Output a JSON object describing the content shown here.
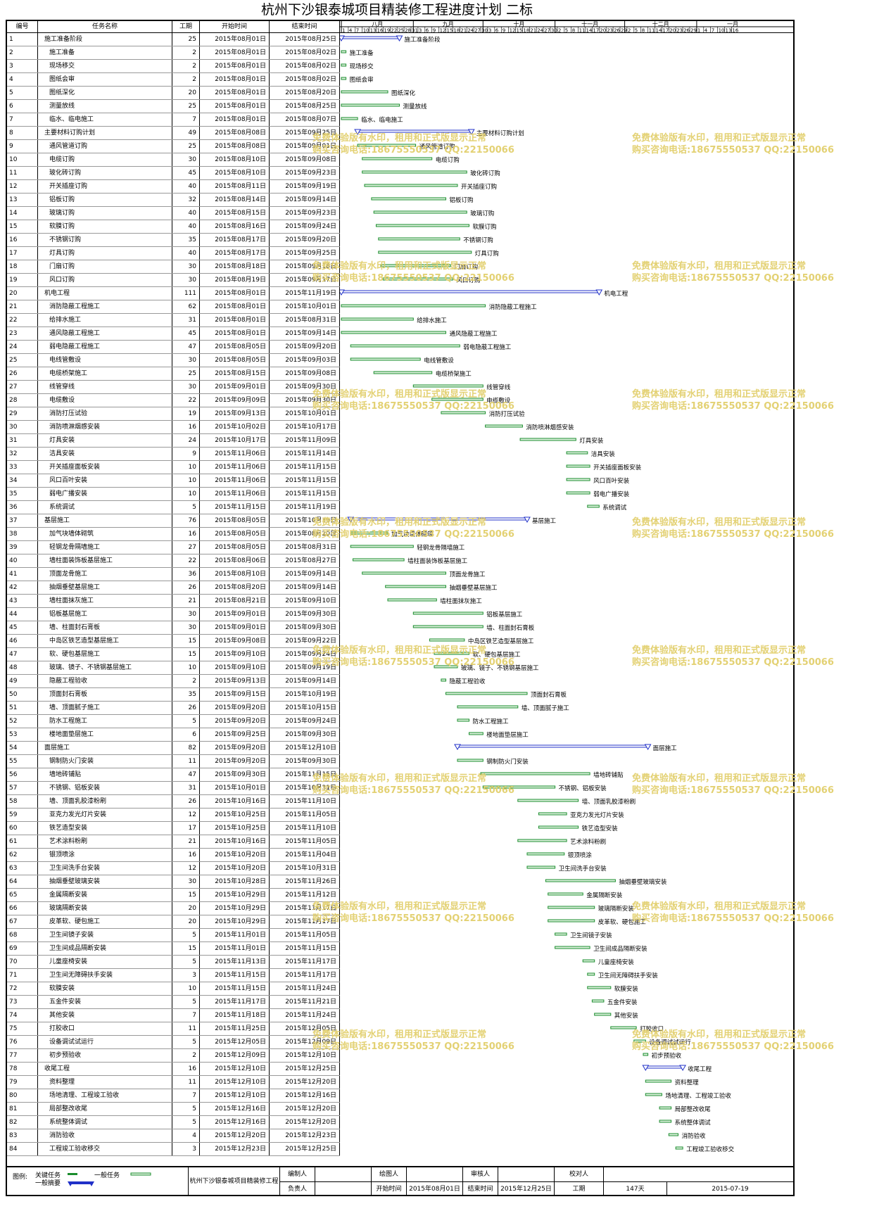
{
  "title": "杭州下沙银泰城项目精装修工程进度计划 二标",
  "headers": {
    "id": "编号",
    "name": "任务名称",
    "dur": "工期",
    "start": "开始时间",
    "end": "结束时间"
  },
  "months": [
    "八月",
    "九月",
    "十月",
    "十一月",
    "十二月",
    "一月"
  ],
  "days": [
    [
      1,
      4,
      7,
      10,
      13,
      16,
      19,
      22,
      25,
      28,
      31
    ],
    [
      3,
      6,
      9,
      12,
      15,
      18,
      21,
      24,
      27,
      30
    ],
    [
      3,
      6,
      9,
      12,
      15,
      18,
      21,
      24,
      27,
      30
    ],
    [
      2,
      5,
      8,
      11,
      14,
      17,
      20,
      23,
      26,
      29
    ],
    [
      2,
      5,
      8,
      11,
      14,
      17,
      20,
      23,
      26,
      29
    ],
    [
      1,
      4,
      7,
      10,
      13,
      16
    ]
  ],
  "chart_data": {
    "type": "gantt",
    "tasks": [
      {
        "id": "1",
        "name": "施工准备阶段",
        "dur": "25",
        "start": "2015年08月01日",
        "end": "2015年08月25日",
        "summary": true
      },
      {
        "id": "2",
        "name": "施工准备",
        "dur": "2",
        "start": "2015年08月01日",
        "end": "2015年08月02日",
        "summary": false
      },
      {
        "id": "3",
        "name": "现场移交",
        "dur": "2",
        "start": "2015年08月01日",
        "end": "2015年08月02日",
        "summary": false
      },
      {
        "id": "4",
        "name": "图纸会审",
        "dur": "2",
        "start": "2015年08月01日",
        "end": "2015年08月02日",
        "summary": false
      },
      {
        "id": "5",
        "name": "图纸深化",
        "dur": "20",
        "start": "2015年08月01日",
        "end": "2015年08月20日",
        "summary": false
      },
      {
        "id": "6",
        "name": "测量放线",
        "dur": "25",
        "start": "2015年08月01日",
        "end": "2015年08月25日",
        "summary": false
      },
      {
        "id": "7",
        "name": "临水、临电施工",
        "dur": "7",
        "start": "2015年08月01日",
        "end": "2015年08月07日",
        "summary": false
      },
      {
        "id": "8",
        "name": "主要材料订购计划",
        "dur": "49",
        "start": "2015年08月08日",
        "end": "2015年09月25日",
        "summary": true
      },
      {
        "id": "9",
        "name": "通风管道订购",
        "dur": "25",
        "start": "2015年08月08日",
        "end": "2015年09月01日",
        "summary": false
      },
      {
        "id": "10",
        "name": "电缆订购",
        "dur": "30",
        "start": "2015年08月10日",
        "end": "2015年09月08日",
        "summary": false
      },
      {
        "id": "11",
        "name": "玻化砖订购",
        "dur": "45",
        "start": "2015年08月10日",
        "end": "2015年09月23日",
        "summary": false
      },
      {
        "id": "12",
        "name": "开关插座订购",
        "dur": "40",
        "start": "2015年08月11日",
        "end": "2015年09月19日",
        "summary": false
      },
      {
        "id": "13",
        "name": "铝板订购",
        "dur": "32",
        "start": "2015年08月14日",
        "end": "2015年09月14日",
        "summary": false
      },
      {
        "id": "14",
        "name": "玻璃订购",
        "dur": "40",
        "start": "2015年08月15日",
        "end": "2015年09月23日",
        "summary": false
      },
      {
        "id": "15",
        "name": "软膜订购",
        "dur": "40",
        "start": "2015年08月16日",
        "end": "2015年09月24日",
        "summary": false
      },
      {
        "id": "16",
        "name": "不锈钢订购",
        "dur": "35",
        "start": "2015年08月17日",
        "end": "2015年09月20日",
        "summary": false
      },
      {
        "id": "17",
        "name": "灯具订购",
        "dur": "40",
        "start": "2015年08月17日",
        "end": "2015年09月25日",
        "summary": false
      },
      {
        "id": "18",
        "name": "门扇订购",
        "dur": "30",
        "start": "2015年08月18日",
        "end": "2015年09月16日",
        "summary": false
      },
      {
        "id": "19",
        "name": "风口订购",
        "dur": "30",
        "start": "2015年08月19日",
        "end": "2015年09月17日",
        "summary": false
      },
      {
        "id": "20",
        "name": "机电工程",
        "dur": "111",
        "start": "2015年08月01日",
        "end": "2015年11月19日",
        "summary": true
      },
      {
        "id": "21",
        "name": "消防隐蔽工程施工",
        "dur": "62",
        "start": "2015年08月01日",
        "end": "2015年10月01日",
        "summary": false
      },
      {
        "id": "22",
        "name": "给排水施工",
        "dur": "31",
        "start": "2015年08月01日",
        "end": "2015年08月31日",
        "summary": false
      },
      {
        "id": "23",
        "name": "通风隐蔽工程施工",
        "dur": "45",
        "start": "2015年08月01日",
        "end": "2015年09月14日",
        "summary": false
      },
      {
        "id": "24",
        "name": "弱电隐蔽工程施工",
        "dur": "47",
        "start": "2015年08月05日",
        "end": "2015年09月20日",
        "summary": false
      },
      {
        "id": "25",
        "name": "电线管敷设",
        "dur": "30",
        "start": "2015年08月05日",
        "end": "2015年09月03日",
        "summary": false
      },
      {
        "id": "26",
        "name": "电缆桥架施工",
        "dur": "25",
        "start": "2015年08月15日",
        "end": "2015年09月08日",
        "summary": false
      },
      {
        "id": "27",
        "name": "线管穿线",
        "dur": "30",
        "start": "2015年09月01日",
        "end": "2015年09月30日",
        "summary": false
      },
      {
        "id": "28",
        "name": "电缆敷设",
        "dur": "22",
        "start": "2015年09月09日",
        "end": "2015年09月30日",
        "summary": false
      },
      {
        "id": "29",
        "name": "消防打压试验",
        "dur": "19",
        "start": "2015年09月13日",
        "end": "2015年10月01日",
        "summary": false
      },
      {
        "id": "30",
        "name": "消防喷淋烟感安装",
        "dur": "16",
        "start": "2015年10月02日",
        "end": "2015年10月17日",
        "summary": false
      },
      {
        "id": "31",
        "name": "灯具安装",
        "dur": "24",
        "start": "2015年10月17日",
        "end": "2015年11月09日",
        "summary": false
      },
      {
        "id": "32",
        "name": "洁具安装",
        "dur": "9",
        "start": "2015年11月06日",
        "end": "2015年11月14日",
        "summary": false
      },
      {
        "id": "33",
        "name": "开关插座面板安装",
        "dur": "10",
        "start": "2015年11月06日",
        "end": "2015年11月15日",
        "summary": false
      },
      {
        "id": "34",
        "name": "风口百叶安装",
        "dur": "10",
        "start": "2015年11月06日",
        "end": "2015年11月15日",
        "summary": false
      },
      {
        "id": "35",
        "name": "弱电广播安装",
        "dur": "10",
        "start": "2015年11月06日",
        "end": "2015年11月15日",
        "summary": false
      },
      {
        "id": "36",
        "name": "系统调试",
        "dur": "5",
        "start": "2015年11月15日",
        "end": "2015年11月19日",
        "summary": false
      },
      {
        "id": "37",
        "name": "基层施工",
        "dur": "76",
        "start": "2015年08月05日",
        "end": "2015年10月19日",
        "summary": true
      },
      {
        "id": "38",
        "name": "加气块墙体砌筑",
        "dur": "16",
        "start": "2015年08月05日",
        "end": "2015年08月20日",
        "summary": false
      },
      {
        "id": "39",
        "name": "轻钢龙骨隔墙施工",
        "dur": "27",
        "start": "2015年08月05日",
        "end": "2015年08月31日",
        "summary": false
      },
      {
        "id": "40",
        "name": "墙柱面装饰板基层施工",
        "dur": "22",
        "start": "2015年08月06日",
        "end": "2015年08月27日",
        "summary": false
      },
      {
        "id": "41",
        "name": "顶面龙骨施工",
        "dur": "36",
        "start": "2015年08月10日",
        "end": "2015年09月14日",
        "summary": false
      },
      {
        "id": "42",
        "name": "抽烟垂壁基层施工",
        "dur": "26",
        "start": "2015年08月20日",
        "end": "2015年09月14日",
        "summary": false
      },
      {
        "id": "43",
        "name": "墙柱面抹灰施工",
        "dur": "21",
        "start": "2015年08月21日",
        "end": "2015年09月10日",
        "summary": false
      },
      {
        "id": "44",
        "name": "铝板基层施工",
        "dur": "30",
        "start": "2015年09月01日",
        "end": "2015年09月30日",
        "summary": false
      },
      {
        "id": "45",
        "name": "墙、柱面封石膏板",
        "dur": "30",
        "start": "2015年09月01日",
        "end": "2015年09月30日",
        "summary": false
      },
      {
        "id": "46",
        "name": "中岛区铁艺造型基层施工",
        "dur": "15",
        "start": "2015年09月08日",
        "end": "2015年09月22日",
        "summary": false
      },
      {
        "id": "47",
        "name": "软、硬包基层施工",
        "dur": "15",
        "start": "2015年09月10日",
        "end": "2015年09月24日",
        "summary": false
      },
      {
        "id": "48",
        "name": "玻璃、镜子、不锈钢基层施工",
        "dur": "10",
        "start": "2015年09月10日",
        "end": "2015年09月19日",
        "summary": false
      },
      {
        "id": "49",
        "name": "隐蔽工程验收",
        "dur": "2",
        "start": "2015年09月13日",
        "end": "2015年09月14日",
        "summary": false
      },
      {
        "id": "50",
        "name": "顶面封石膏板",
        "dur": "35",
        "start": "2015年09月15日",
        "end": "2015年10月19日",
        "summary": false
      },
      {
        "id": "51",
        "name": "墙、顶面腻子施工",
        "dur": "26",
        "start": "2015年09月20日",
        "end": "2015年10月15日",
        "summary": false
      },
      {
        "id": "52",
        "name": "防水工程施工",
        "dur": "5",
        "start": "2015年09月20日",
        "end": "2015年09月24日",
        "summary": false
      },
      {
        "id": "53",
        "name": "楼地面垫层施工",
        "dur": "6",
        "start": "2015年09月25日",
        "end": "2015年09月30日",
        "summary": false
      },
      {
        "id": "54",
        "name": "面层施工",
        "dur": "82",
        "start": "2015年09月20日",
        "end": "2015年12月10日",
        "summary": true
      },
      {
        "id": "55",
        "name": "钢制防火门安装",
        "dur": "11",
        "start": "2015年09月20日",
        "end": "2015年09月30日",
        "summary": false
      },
      {
        "id": "56",
        "name": "墙地砖铺贴",
        "dur": "47",
        "start": "2015年09月30日",
        "end": "2015年11月15日",
        "summary": false
      },
      {
        "id": "57",
        "name": "不锈钢、铝板安装",
        "dur": "31",
        "start": "2015年10月01日",
        "end": "2015年10月31日",
        "summary": false
      },
      {
        "id": "58",
        "name": "墙、顶面乳胶漆粉刷",
        "dur": "26",
        "start": "2015年10月16日",
        "end": "2015年11月10日",
        "summary": false
      },
      {
        "id": "59",
        "name": "亚克力发光灯片安装",
        "dur": "12",
        "start": "2015年10月25日",
        "end": "2015年11月05日",
        "summary": false
      },
      {
        "id": "60",
        "name": "铁艺造型安装",
        "dur": "17",
        "start": "2015年10月25日",
        "end": "2015年11月10日",
        "summary": false
      },
      {
        "id": "61",
        "name": "艺术涂料粉刷",
        "dur": "21",
        "start": "2015年10月16日",
        "end": "2015年11月05日",
        "summary": false
      },
      {
        "id": "62",
        "name": "银顶喷涂",
        "dur": "16",
        "start": "2015年10月20日",
        "end": "2015年11月04日",
        "summary": false
      },
      {
        "id": "63",
        "name": "卫生间洗手台安装",
        "dur": "12",
        "start": "2015年10月20日",
        "end": "2015年10月31日",
        "summary": false
      },
      {
        "id": "64",
        "name": "抽烟垂壁玻璃安装",
        "dur": "30",
        "start": "2015年10月28日",
        "end": "2015年11月26日",
        "summary": false
      },
      {
        "id": "65",
        "name": "金属隔断安装",
        "dur": "15",
        "start": "2015年10月29日",
        "end": "2015年11月12日",
        "summary": false
      },
      {
        "id": "66",
        "name": "玻璃隔断安装",
        "dur": "20",
        "start": "2015年10月29日",
        "end": "2015年11月17日",
        "summary": false
      },
      {
        "id": "67",
        "name": "皮革软、硬包施工",
        "dur": "20",
        "start": "2015年10月29日",
        "end": "2015年11月17日",
        "summary": false
      },
      {
        "id": "68",
        "name": "卫生间镜子安装",
        "dur": "5",
        "start": "2015年11月01日",
        "end": "2015年11月05日",
        "summary": false
      },
      {
        "id": "69",
        "name": "卫生间成品隔断安装",
        "dur": "15",
        "start": "2015年11月01日",
        "end": "2015年11月15日",
        "summary": false
      },
      {
        "id": "70",
        "name": "儿童座椅安装",
        "dur": "5",
        "start": "2015年11月13日",
        "end": "2015年11月17日",
        "summary": false
      },
      {
        "id": "71",
        "name": "卫生间无障碍扶手安装",
        "dur": "3",
        "start": "2015年11月15日",
        "end": "2015年11月17日",
        "summary": false
      },
      {
        "id": "72",
        "name": "软膜安装",
        "dur": "10",
        "start": "2015年11月15日",
        "end": "2015年11月24日",
        "summary": false
      },
      {
        "id": "73",
        "name": "五金件安装",
        "dur": "5",
        "start": "2015年11月17日",
        "end": "2015年11月21日",
        "summary": false
      },
      {
        "id": "74",
        "name": "其他安装",
        "dur": "7",
        "start": "2015年11月18日",
        "end": "2015年11月24日",
        "summary": false
      },
      {
        "id": "75",
        "name": "打胶收口",
        "dur": "11",
        "start": "2015年11月25日",
        "end": "2015年12月05日",
        "summary": false
      },
      {
        "id": "76",
        "name": "设备调试试运行",
        "dur": "5",
        "start": "2015年12月05日",
        "end": "2015年12月09日",
        "summary": false
      },
      {
        "id": "77",
        "name": "初步预验收",
        "dur": "2",
        "start": "2015年12月09日",
        "end": "2015年12月10日",
        "summary": false
      },
      {
        "id": "78",
        "name": "收尾工程",
        "dur": "16",
        "start": "2015年12月10日",
        "end": "2015年12月25日",
        "summary": true
      },
      {
        "id": "79",
        "name": "资料整理",
        "dur": "11",
        "start": "2015年12月10日",
        "end": "2015年12月20日",
        "summary": false
      },
      {
        "id": "80",
        "name": "场地清理、工程竣工验收",
        "dur": "7",
        "start": "2015年12月10日",
        "end": "2015年12月16日",
        "summary": false
      },
      {
        "id": "81",
        "name": "局部整改收尾",
        "dur": "5",
        "start": "2015年12月16日",
        "end": "2015年12月20日",
        "summary": false
      },
      {
        "id": "82",
        "name": "系统整体调试",
        "dur": "5",
        "start": "2015年12月16日",
        "end": "2015年12月20日",
        "summary": false
      },
      {
        "id": "83",
        "name": "消防验收",
        "dur": "4",
        "start": "2015年12月20日",
        "end": "2015年12月23日",
        "summary": false
      },
      {
        "id": "84",
        "name": "工程竣工验收移交",
        "dur": "3",
        "start": "2015年12月23日",
        "end": "2015年12月25日",
        "summary": false
      }
    ]
  },
  "footer": {
    "legend_label": "图例:",
    "key_task": "关键任务",
    "normal_task": "一般任务",
    "summary_task": "一般摘要",
    "project": "杭州下沙银泰城项目精装修工程",
    "compiler_label": "编制人",
    "drafter_label": "绘图人",
    "reviewer_label": "审核人",
    "checker_label": "校对人",
    "responsible_label": "负责人",
    "start_label": "开始时间",
    "start_value": "2015年08月01日",
    "end_label": "结束时间",
    "end_value": "2015年12月25日",
    "duration_label": "工期",
    "duration_value": "147天",
    "date_value": "2015-07-19"
  },
  "watermark": {
    "line1": "免费体验版有水印，租用和正式版显示正常",
    "line2": "购买咨询电话:18675550537 QQ:22150066"
  },
  "colors": {
    "task_bar": "#1a8c2c",
    "summary_bar": "#2030c8",
    "task_bar_fill": "#dff2df"
  }
}
